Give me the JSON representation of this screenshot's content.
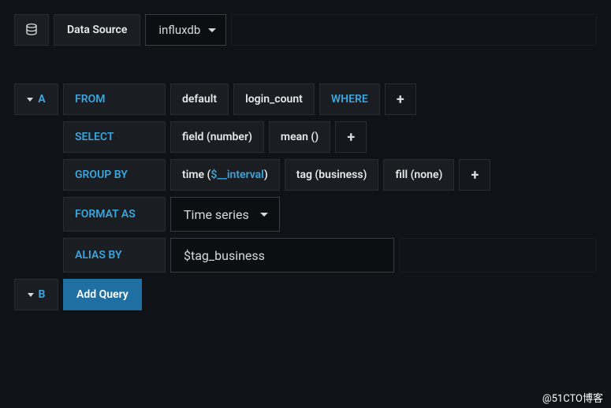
{
  "header": {
    "ds_label": "Data Source",
    "ds_value": "influxdb"
  },
  "queries": [
    {
      "letter": "A",
      "rows": {
        "from": {
          "keyword": "FROM",
          "policy": "default",
          "measurement": "login_count",
          "where_label": "WHERE"
        },
        "select": {
          "keyword": "SELECT",
          "field": "field (number)",
          "agg": "mean ()"
        },
        "group_by": {
          "keyword": "GROUP BY",
          "time_prefix": "time (",
          "time_var": "$__interval",
          "time_suffix": ")",
          "tag": "tag (business)",
          "fill": "fill (none)"
        },
        "format": {
          "keyword": "FORMAT AS",
          "value": "Time series"
        },
        "alias": {
          "keyword": "ALIAS BY",
          "value": "$tag_business"
        }
      }
    },
    {
      "letter": "B",
      "add_label": "Add Query"
    }
  ],
  "watermark": "@51CTO博客"
}
